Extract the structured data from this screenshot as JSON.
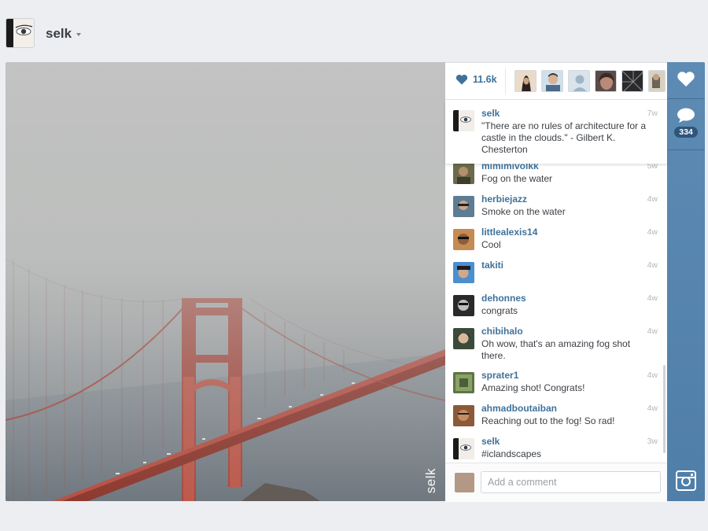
{
  "header": {
    "username": "selk"
  },
  "photo": {
    "watermark": "selk"
  },
  "likes": {
    "count": "11.6k"
  },
  "caption": {
    "user": "selk",
    "time": "7w",
    "text": "\"There are no rules of architecture for a castle in the clouds.\" - Gilbert K. Chesterton"
  },
  "comments": [
    {
      "user": "mimimivolkk",
      "time": "5w",
      "text": "Fog on the water"
    },
    {
      "user": "herbiejazz",
      "time": "4w",
      "text": "Smoke on the water"
    },
    {
      "user": "littlealexis14",
      "time": "4w",
      "text": "Cool"
    },
    {
      "user": "takiti",
      "time": "4w",
      "text": ""
    },
    {
      "user": "dehonnes",
      "time": "4w",
      "text": "congrats"
    },
    {
      "user": "chibihalo",
      "time": "4w",
      "text": "Oh wow, that's an amazing fog shot there."
    },
    {
      "user": "sprater1",
      "time": "4w",
      "text": "Amazing shot! Congrats!"
    },
    {
      "user": "ahmadboutaiban",
      "time": "4w",
      "text": "Reaching out to the fog! So rad!"
    },
    {
      "user": "selk",
      "time": "3w",
      "text": "#iclandscapes"
    }
  ],
  "comment_box": {
    "placeholder": "Add a comment"
  },
  "rail": {
    "comment_count": "334"
  },
  "colors": {
    "accent": "#3f729b",
    "rail": "#5786b0",
    "badge": "#2f557a"
  },
  "icons": [
    "heart-icon",
    "comment-bubble-icon",
    "instagram-camera-icon"
  ]
}
